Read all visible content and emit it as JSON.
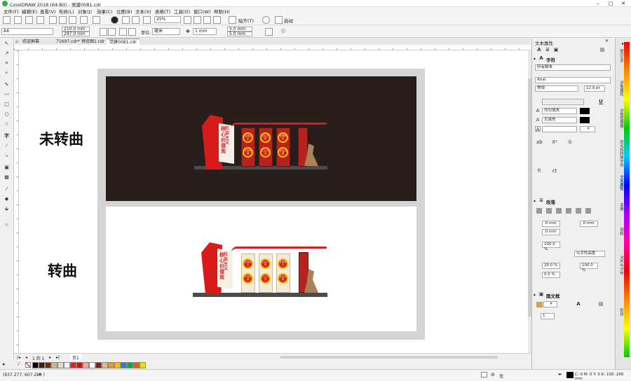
{
  "app": {
    "title": "CorelDRAW 2018 (64-Bit) - 党建0081.cdr"
  },
  "menu": [
    "文件(F)",
    "编辑(E)",
    "查看(V)",
    "布局(L)",
    "对象(J)",
    "效果(C)",
    "位图(B)",
    "文本(X)",
    "表格(T)",
    "工具(O)",
    "窗口(W)",
    "帮助(H)"
  ],
  "toolbar": {
    "zoom": "25%",
    "snap": "贴齐(T)",
    "launch": "启动"
  },
  "propbar": {
    "page_size": "A4",
    "width": "210.0 mm",
    "height": "297.0 mm",
    "unit_label": "单位:",
    "unit": "毫米",
    "nudge": "1 mm",
    "dup_x": "5.0 mm",
    "dup_y": "5.0 mm"
  },
  "tabs": [
    "欢迎屏幕",
    "71697.cdr*",
    "预览图1.cdr",
    "党建0081.cdr"
  ],
  "canvas": {
    "label1": "未转曲",
    "label2": "转曲"
  },
  "artwork": {
    "slogan_v": "社会主义",
    "slogan_big": "核心价值观",
    "circles1": [
      "富强民主",
      "自由平等",
      "爱国敬业"
    ],
    "circles2": [
      "文明和谐",
      "公正法治",
      "诚信友善"
    ]
  },
  "panel": {
    "title": "文本属性",
    "section_char": "字符",
    "script": "所有脚本",
    "font": "Arial",
    "style": "常规",
    "size": "12.0 pt",
    "fill1": "均匀填充",
    "fill2": "无填充",
    "section_para": "段落",
    "indent1": ".0 mm",
    "indent2": ".0 mm",
    "indent3": ".0 mm",
    "pct1": "100.0 %",
    "pct2": "%字符高度",
    "pct3": "20.0 %",
    "pct4": "100.0 %",
    "pct5": "0.0 %",
    "section_frame": "图文框",
    "cols": "1"
  },
  "sidetabs": [
    "提示(N)",
    "对象属性",
    "对象管理器",
    "符号和特殊字符",
    "文本属性",
    "变换",
    "调和",
    "对齐与分布",
    "形状"
  ],
  "pages": {
    "current": "1 的 1",
    "page_tab": "页1"
  },
  "status": {
    "coords": "(637.277, 607.283 )",
    "fill_none": "无",
    "outline": "C: 0 M: 0 Y: 0 K: 100  .200 mm"
  },
  "palette": [
    "#000000",
    "#3b1f12",
    "#6d2c14",
    "#c8b89a",
    "#e8dcc0",
    "#ffffff",
    "#e61e2a",
    "#b41e1e",
    "#f4a6a0",
    "#ffffff",
    "#8a1e14",
    "#d2c39b",
    "#e6a020",
    "#f0c020",
    "#2a7fc0",
    "#1ea050",
    "#e85a1e",
    "#f0e000"
  ]
}
